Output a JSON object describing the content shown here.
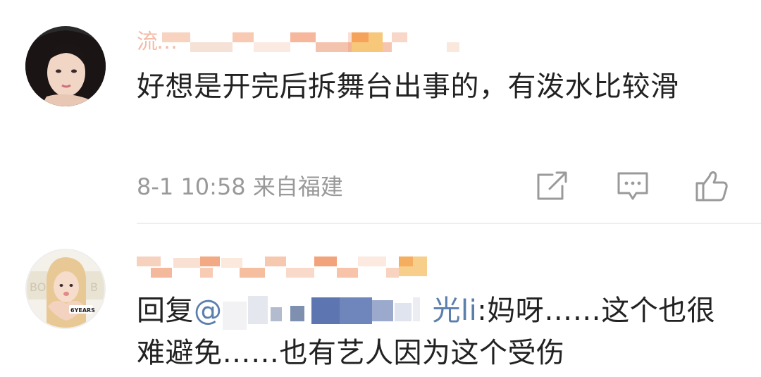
{
  "comments": [
    {
      "username": "流…",
      "text": "好想是开完后拆舞台出事的，有泼水比较滑",
      "time": "8-1 10:58",
      "location": "来自福建"
    },
    {
      "reply_prefix": "回复",
      "mention_at": "@",
      "mention_tail": "光li",
      "reply_body": ":妈呀……这个也很难避免……也有艺人因为这个受伤",
      "avatar_badge": "6YEARS"
    }
  ],
  "colors": {
    "mention": "#5b7fad",
    "meta": "#999999",
    "text": "#222222",
    "divider": "#eeeeee"
  },
  "icons": [
    "share-icon",
    "comment-icon",
    "like-icon"
  ]
}
